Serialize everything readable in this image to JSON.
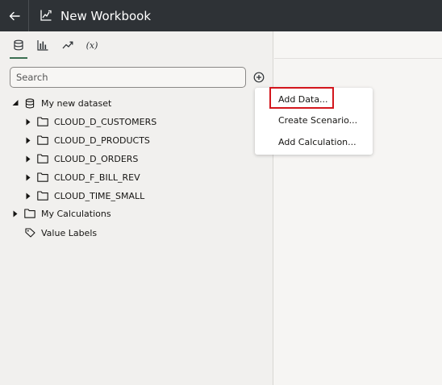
{
  "titlebar": {
    "back_icon": "arrow-left-icon",
    "workbook_icon": "chart-edit-icon",
    "title": "New Workbook"
  },
  "panel_tabs": [
    {
      "icon": "database-icon",
      "active": true
    },
    {
      "icon": "bar-chart-icon",
      "active": false
    },
    {
      "icon": "trend-arrow-icon",
      "active": false
    },
    {
      "label": "(x)",
      "active": false
    }
  ],
  "search": {
    "placeholder": "Search",
    "value": ""
  },
  "add_button_icon": "plus-circle-icon",
  "tree": {
    "dataset": {
      "label": "My new dataset",
      "expanded": true
    },
    "tables": [
      {
        "label": "CLOUD_D_CUSTOMERS"
      },
      {
        "label": "CLOUD_D_PRODUCTS"
      },
      {
        "label": "CLOUD_D_ORDERS"
      },
      {
        "label": "CLOUD_F_BILL_REV"
      },
      {
        "label": "CLOUD_TIME_SMALL"
      }
    ],
    "calculations": {
      "label": "My Calculations",
      "expanded": false
    },
    "value_labels": {
      "label": "Value Labels"
    }
  },
  "add_menu": {
    "items": [
      {
        "label": "Add Data...",
        "highlighted": true
      },
      {
        "label": "Create Scenario..."
      },
      {
        "label": "Add Calculation..."
      }
    ]
  },
  "colors": {
    "titlebar": "#2e3236",
    "active_tab": "#3b6f52",
    "highlight_border": "#d3161d"
  }
}
